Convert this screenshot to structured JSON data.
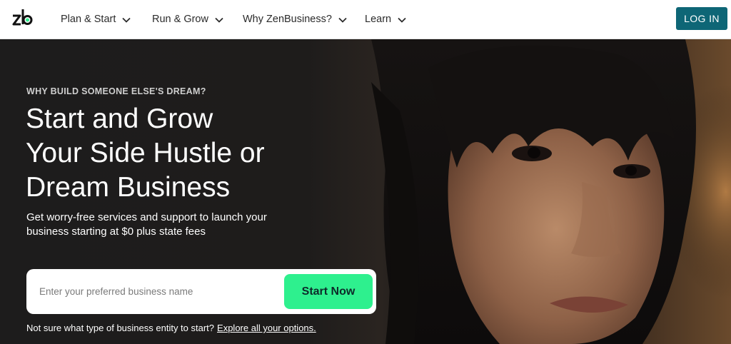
{
  "brand": {
    "logo_text": "zb",
    "accent_color": "#2ef08e",
    "primary_color": "#0e6676"
  },
  "nav": {
    "items": [
      {
        "label": "Plan & Start",
        "icon": "chevron-down-icon"
      },
      {
        "label": "Run & Grow",
        "icon": "chevron-down-icon"
      },
      {
        "label": "Why ZenBusiness?",
        "icon": "chevron-down-icon"
      },
      {
        "label": "Learn",
        "icon": "chevron-down-icon"
      }
    ],
    "login_label": "LOG IN"
  },
  "hero": {
    "eyebrow": "WHY BUILD SOMEONE ELSE'S DREAM?",
    "headline_lines": [
      "Start and Grow",
      "Your Side Hustle or",
      "Dream Business"
    ],
    "subtext_lines": [
      "Get worry-free services and support to launch your",
      "business starting at $0 plus state fees"
    ],
    "search": {
      "placeholder": "Enter your preferred business name",
      "value": "",
      "button_label": "Start Now"
    },
    "helper_text": "Not sure what type of business entity to start?",
    "helper_link": "Explore all your options."
  }
}
